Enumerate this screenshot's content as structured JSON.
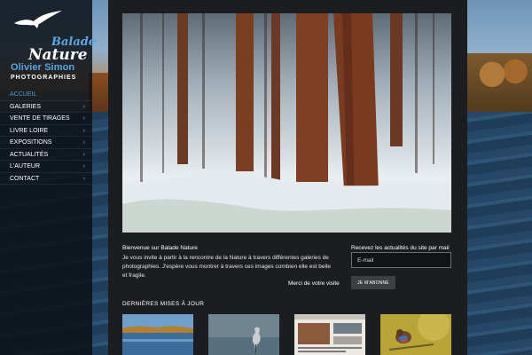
{
  "logo": {
    "line1": "Balade",
    "line2": "Nature",
    "line3": "Olivier Simon",
    "line4": "PHOTOGRAPHIES"
  },
  "nav": [
    {
      "label": "ACCUEIL",
      "active": true,
      "arrow": ""
    },
    {
      "label": "GALERIES",
      "arrow": "›"
    },
    {
      "label": "VENTE DE TIRAGES",
      "arrow": "›"
    },
    {
      "label": "LIVRE LOIRE",
      "arrow": "›"
    },
    {
      "label": "EXPOSITIONS",
      "arrow": "›"
    },
    {
      "label": "ACTUALITÉS",
      "arrow": "›"
    },
    {
      "label": "L'AUTEUR",
      "arrow": "›"
    },
    {
      "label": "CONTACT",
      "arrow": "›"
    }
  ],
  "welcome": {
    "title": "Bienvenue sur Balade Nature",
    "text": "Je vous invite à partir à la rencontre de la Nature à travers différentes galeries de photographies. J'espère vous montrer à travers ces images combien elle est belle et fragile.",
    "thanks": "Merci de votre visite"
  },
  "newsletter": {
    "title": "Recevez les actualités du site par mail",
    "placeholder": "E-mail",
    "button": "JE M'ABONNE"
  },
  "updates": {
    "title": "DERNIÈRES MISES À JOUR"
  },
  "colors": {
    "accent": "#4d9bdc",
    "logo_blue": "#5aa6e0",
    "panel": "#1b1d20",
    "sidebar": "#0c1016"
  }
}
